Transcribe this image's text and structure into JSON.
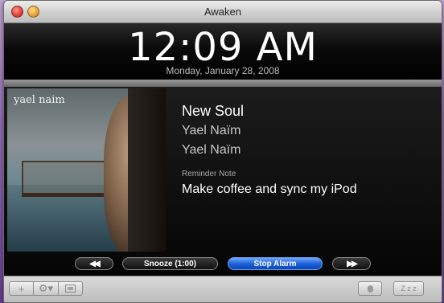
{
  "window": {
    "title": "Awaken"
  },
  "clock": {
    "time": "12:09 AM",
    "date": "Monday, January 28, 2008"
  },
  "now_playing": {
    "art_logo_text": "yael naim",
    "track": "New Soul",
    "artist": "Yael Naïm",
    "album": "Yael Naïm",
    "note_label": "Reminder Note",
    "note": "Make coffee and sync my iPod"
  },
  "controls": {
    "rewind_glyph": "◀◀",
    "snooze_label": "Snooze (1:00)",
    "stop_label": "Stop Alarm",
    "forward_glyph": "▶▶"
  },
  "toolbar": {
    "add_glyph": "+",
    "gear_glyph": "⚙▾",
    "sleep_glyph": "Z z z",
    "icons": [
      "add-icon",
      "gear-icon",
      "screen-icon",
      "microphone-icon",
      "sleep-icon"
    ]
  },
  "colors": {
    "stop_accent": "#1a5ed6",
    "panel_bg": "#050505"
  }
}
